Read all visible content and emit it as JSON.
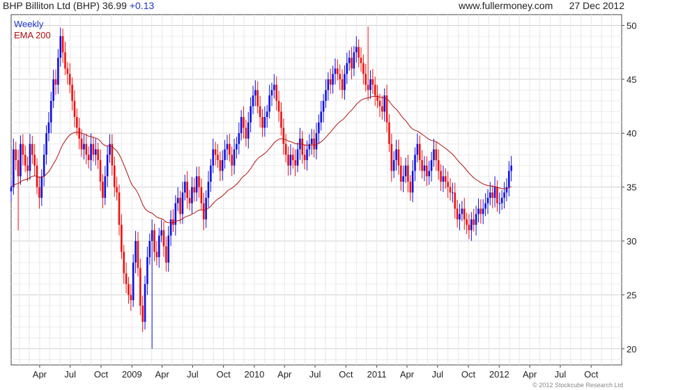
{
  "header": {
    "title": "BHP Billiton Ltd (BHP)",
    "price": "36.99",
    "change": "+0.13",
    "source": "www.fullermoney.com",
    "date": "27 Dec 2012"
  },
  "legend": {
    "weekly": "Weekly",
    "ema": "EMA 200"
  },
  "footer": {
    "copyright": "© 2012 Stockcube Research Ltd"
  },
  "colors": {
    "up": "#1010e0",
    "down": "#ee1010",
    "ema": "#b01010",
    "grid": "#dcdcdc"
  },
  "chart_data": {
    "type": "candlestick",
    "title": "BHP Billiton Ltd (BHP)",
    "grid": true,
    "legend_position": "top-left",
    "y_axis_position": "right",
    "ylim": [
      18.5,
      51
    ],
    "y_ticks": [
      20,
      25,
      30,
      35,
      40,
      45,
      50
    ],
    "x_range": [
      "2008-01-07",
      "2012-12-31"
    ],
    "x_ticks": [
      {
        "label": "Apr",
        "date": "2008-04-01"
      },
      {
        "label": "Jul",
        "date": "2008-07-01"
      },
      {
        "label": "Oct",
        "date": "2008-10-01"
      },
      {
        "label": "2009",
        "date": "2009-01-01"
      },
      {
        "label": "Apr",
        "date": "2009-04-01"
      },
      {
        "label": "Jul",
        "date": "2009-07-01"
      },
      {
        "label": "Oct",
        "date": "2009-10-01"
      },
      {
        "label": "2010",
        "date": "2010-01-01"
      },
      {
        "label": "Apr",
        "date": "2010-04-01"
      },
      {
        "label": "Jul",
        "date": "2010-07-01"
      },
      {
        "label": "Oct",
        "date": "2010-10-01"
      },
      {
        "label": "2011",
        "date": "2011-01-01"
      },
      {
        "label": "Apr",
        "date": "2011-04-01"
      },
      {
        "label": "Jul",
        "date": "2011-07-01"
      },
      {
        "label": "Oct",
        "date": "2011-10-01"
      },
      {
        "label": "2012",
        "date": "2012-01-01"
      },
      {
        "label": "Apr",
        "date": "2012-04-01"
      },
      {
        "label": "Jul",
        "date": "2012-07-01"
      },
      {
        "label": "Oct",
        "date": "2012-10-01"
      }
    ],
    "price_series": {
      "name": "Weekly",
      "frequency": "weekly",
      "start": "2008-01-07",
      "closes": [
        35.0,
        38.5,
        37.5,
        36.0,
        39.0,
        38.0,
        37.0,
        36.5,
        39.0,
        38.0,
        37.0,
        35.0,
        34.0,
        36.0,
        38.0,
        40.0,
        41.0,
        43.0,
        45.0,
        44.5,
        47.0,
        49.0,
        47.5,
        46.0,
        45.5,
        44.5,
        43.0,
        41.5,
        40.5,
        39.5,
        38.5,
        39.0,
        38.0,
        37.5,
        39.0,
        38.0,
        38.5,
        37.5,
        35.5,
        34.0,
        36.0,
        38.0,
        39.0,
        37.0,
        35.0,
        34.5,
        31.5,
        29.0,
        27.0,
        26.0,
        25.0,
        24.5,
        28.0,
        30.0,
        27.5,
        24.0,
        22.5,
        26.0,
        28.5,
        30.0,
        31.0,
        29.0,
        28.5,
        30.5,
        31.0,
        29.5,
        28.0,
        30.5,
        32.0,
        31.5,
        33.5,
        34.0,
        32.5,
        34.5,
        35.5,
        34.0,
        33.5,
        35.0,
        34.5,
        36.0,
        35.0,
        33.5,
        32.0,
        34.0,
        35.5,
        37.0,
        38.5,
        38.0,
        37.5,
        36.5,
        37.5,
        38.5,
        39.0,
        38.0,
        37.0,
        38.5,
        39.0,
        40.0,
        41.5,
        40.5,
        39.5,
        41.0,
        42.5,
        43.5,
        44.0,
        42.5,
        41.5,
        40.5,
        41.5,
        42.0,
        43.5,
        44.0,
        44.5,
        43.0,
        42.0,
        40.5,
        39.0,
        38.0,
        37.0,
        38.0,
        37.5,
        37.0,
        38.5,
        39.5,
        38.0,
        37.5,
        38.5,
        39.0,
        39.5,
        38.5,
        40.0,
        41.0,
        42.0,
        43.0,
        44.0,
        45.0,
        44.5,
        45.5,
        46.0,
        45.5,
        45.0,
        44.0,
        45.5,
        46.5,
        47.0,
        46.0,
        47.5,
        48.0,
        47.0,
        46.5,
        45.5,
        44.5,
        44.0,
        45.0,
        44.5,
        43.5,
        43.0,
        42.5,
        42.0,
        43.5,
        41.0,
        39.0,
        36.5,
        37.5,
        38.5,
        37.0,
        35.5,
        36.0,
        37.0,
        35.5,
        34.5,
        36.5,
        38.0,
        39.0,
        37.5,
        36.5,
        37.0,
        36.0,
        36.5,
        37.5,
        38.5,
        37.5,
        36.5,
        35.5,
        36.0,
        35.5,
        35.0,
        34.5,
        34.5,
        33.0,
        32.0,
        32.5,
        33.0,
        32.0,
        31.5,
        31.0,
        32.0,
        31.5,
        32.5,
        33.0,
        32.5,
        33.0,
        33.5,
        34.0,
        34.5,
        34.0,
        35.0,
        33.5,
        33.5,
        34.0,
        34.5,
        35.0,
        36.5,
        37.0
      ],
      "lows_highs_note": "",
      "spikes": [
        {
          "index": 60,
          "low": 20.0
        },
        {
          "index": 21,
          "high": 49.8
        },
        {
          "index": 3,
          "low": 31.0
        },
        {
          "index": 152,
          "high": 49.9
        }
      ]
    },
    "ema_series": {
      "name": "EMA 200",
      "period": 200
    }
  }
}
